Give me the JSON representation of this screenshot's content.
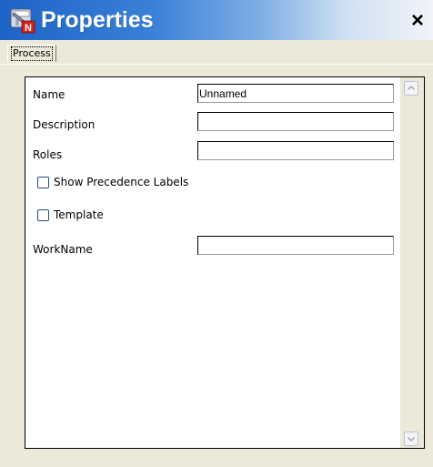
{
  "window": {
    "title": "Properties",
    "close_glyph": "×"
  },
  "tabs": [
    {
      "label": "Process",
      "selected": true
    }
  ],
  "form": {
    "name_label": "Name",
    "name_value": "Unnamed",
    "description_label": "Description",
    "description_value": "",
    "roles_label": "Roles",
    "roles_value": "",
    "show_precedence_label": "Show Precedence Labels",
    "show_precedence_checked": false,
    "template_label": "Template",
    "template_checked": false,
    "workname_label": "WorkName",
    "workname_value": ""
  },
  "icons": {
    "app": "properties-app-icon",
    "scroll_up": "scroll-up-arrow-icon",
    "scroll_down": "scroll-down-arrow-icon"
  },
  "colors": {
    "title_bar_start": "#1d63c6",
    "title_bar_end": "#f2f4f8",
    "window_bg": "#ece9d8",
    "panel_bg": "#ffffff"
  }
}
